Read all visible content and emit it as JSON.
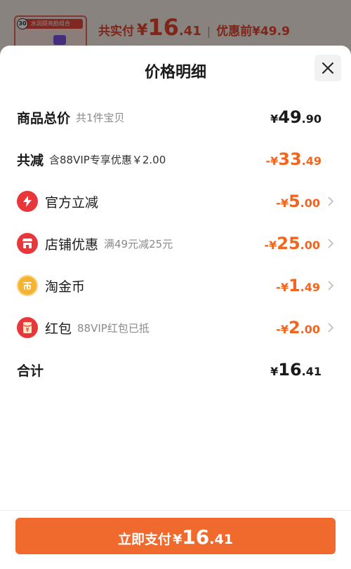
{
  "background": {
    "product_tag": "水润提亮脸组合",
    "product_badge": "30",
    "total_label": "共实付",
    "total_yen": "¥",
    "total_int": "16",
    "total_dec": ".41",
    "separator": "|",
    "original_label": "优惠前¥49.9"
  },
  "sheet": {
    "title": "价格明细",
    "rows": [
      {
        "name": "商品总价",
        "note": "共1件宝贝",
        "prefix": "¥",
        "int": "49",
        "dec": ".90"
      },
      {
        "name": "共减",
        "note": "含88VIP专享优惠￥2.00",
        "prefix": "-¥",
        "int": "33",
        "dec": ".49"
      },
      {
        "name": "官方立减",
        "note": "",
        "prefix": "-¥",
        "int": "5",
        "dec": ".00"
      },
      {
        "name": "店铺优惠",
        "note": "满49元减25元",
        "prefix": "-¥",
        "int": "25",
        "dec": ".00"
      },
      {
        "name": "淘金币",
        "note": "",
        "prefix": "-¥",
        "int": "1",
        "dec": ".49"
      },
      {
        "name": "红包",
        "note": "88VIP红包已抵",
        "prefix": "-¥",
        "int": "2",
        "dec": ".00"
      },
      {
        "name": "合计",
        "note": "",
        "prefix": "¥",
        "int": "16",
        "dec": ".41"
      }
    ]
  },
  "pay_button": {
    "label": "立即支付",
    "yen": "¥",
    "int": "16",
    "dec": ".41"
  },
  "colors": {
    "accent": "#f06a2d",
    "discount": "#f0651f",
    "red_icon": "#e8373a",
    "coin": "#f5b335"
  },
  "icons": {
    "official": "lightning-icon",
    "store": "store-icon",
    "coin": "coin-icon",
    "red_packet": "red-packet-icon",
    "close": "close-icon",
    "arrow": "chevron-right-icon"
  }
}
